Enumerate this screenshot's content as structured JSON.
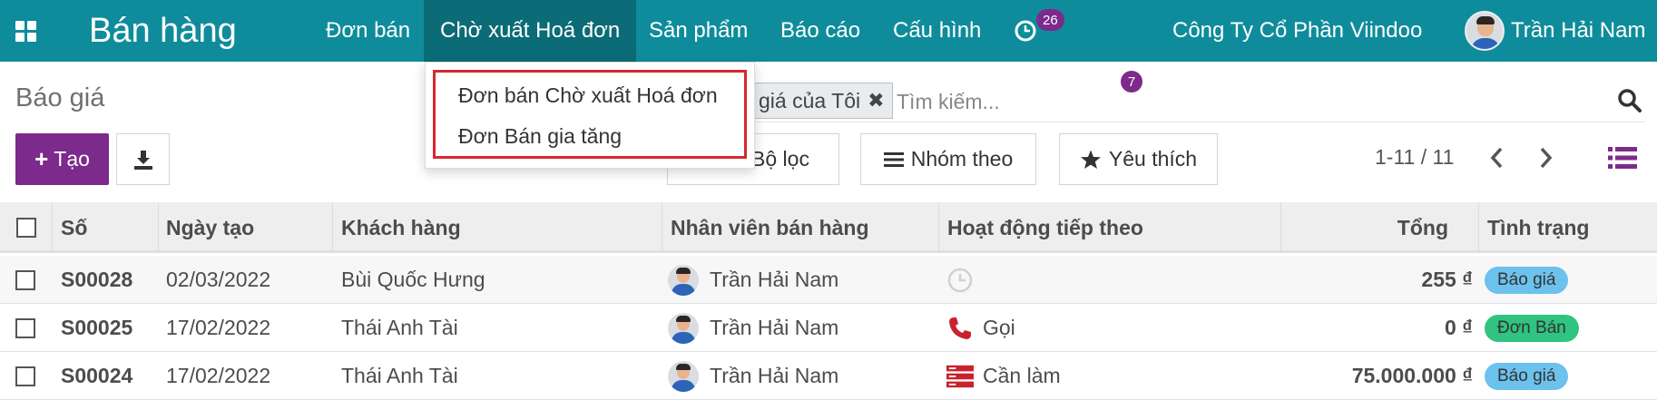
{
  "navbar": {
    "brand": "Bán hàng",
    "menus": [
      "Đơn bán",
      "Chờ xuất Hoá đơn",
      "Sản phẩm",
      "Báo cáo",
      "Cấu hình"
    ],
    "activities_count": "26",
    "messages_count": "7",
    "company": "Công Ty Cổ Phần Viindoo",
    "user": "Trần Hải Nam"
  },
  "dropdown": {
    "items": [
      "Đơn bán Chờ xuất Hoá đơn",
      "Đơn Bán gia tăng"
    ]
  },
  "control_panel": {
    "title": "Báo giá",
    "create_label": "Tạo",
    "search_facet": "giá của Tôi",
    "search_placeholder": "Tìm kiếm...",
    "filter_label": "Bộ lọc",
    "group_label": "Nhóm theo",
    "favorite_label": "Yêu thích",
    "pager": "1-11 / 11"
  },
  "table": {
    "headers": [
      "Số",
      "Ngày tạo",
      "Khách hàng",
      "Nhân viên bán hàng",
      "Hoạt động tiếp theo",
      "Tổng",
      "Tình trạng"
    ],
    "rows": [
      {
        "number": "S00028",
        "date": "02/03/2022",
        "customer": "Bùi Quốc Hưng",
        "salesperson": "Trần Hải Nam",
        "activity": "",
        "activity_icon": "clock-icon",
        "total": "255 ₫",
        "status": "Báo giá"
      },
      {
        "number": "S00025",
        "date": "17/02/2022",
        "customer": "Thái Anh Tài",
        "salesperson": "Trần Hải Nam",
        "activity": "Gọi",
        "activity_icon": "phone-icon",
        "total": "0 ₫",
        "status": "Đơn Bán"
      },
      {
        "number": "S00024",
        "date": "17/02/2022",
        "customer": "Thái Anh Tài",
        "salesperson": "Trần Hải Nam",
        "activity": "Cần làm",
        "activity_icon": "todo-icon",
        "total": "75.000.000 ₫",
        "status": "Báo giá"
      }
    ]
  },
  "colors": {
    "navbar": "#0f8c9b",
    "navbar_active": "#0b6b76",
    "primary": "#7c2a8c",
    "highlight_border": "#d7282f",
    "status_quotation": "#6cc1ed",
    "status_order": "#30c381"
  }
}
